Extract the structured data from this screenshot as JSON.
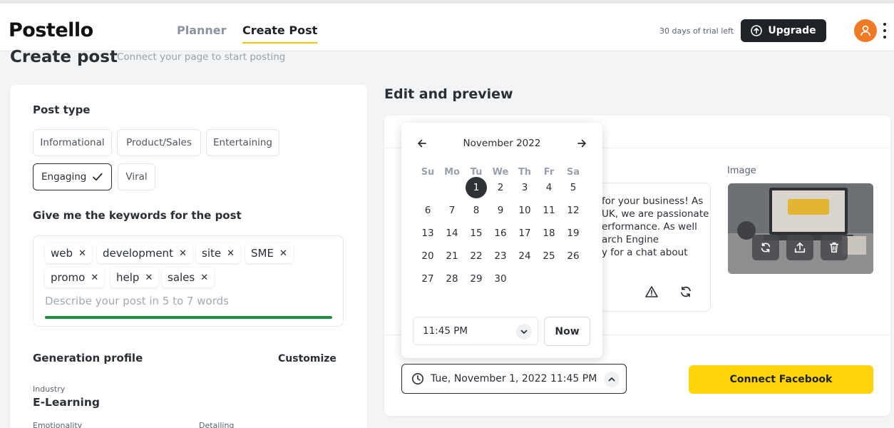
{
  "brand": {
    "logo_text": "Postello",
    "accent": "#f5c400"
  },
  "nav": {
    "planner": "Planner",
    "create_post": "Create Post"
  },
  "header": {
    "trial_text": "30 days of trial left",
    "upgrade_label": "Upgrade"
  },
  "page": {
    "title": "Create post",
    "subtitle": "Connect your page to start posting"
  },
  "post_type": {
    "label": "Post type",
    "options": [
      "Informational",
      "Product/Sales",
      "Entertaining",
      "Engaging",
      "Viral"
    ],
    "selected": "Engaging"
  },
  "keywords": {
    "label": "Give me the keywords for the post",
    "tags": [
      "web",
      "development",
      "site",
      "SME",
      "promo",
      "help",
      "sales"
    ],
    "placeholder": "Describe your post in 5 to 7 words",
    "progress_color": "#1e8f3a"
  },
  "generation_profile": {
    "label": "Generation profile",
    "customize_label": "Customize",
    "industry_label": "Industry",
    "industry_value": "E-Learning",
    "emotionality_label": "Emotionality",
    "detailing_label": "Detailing"
  },
  "preview": {
    "title": "Edit and preview",
    "post_lines": [
      "for your business! As",
      "UK, we are passionate",
      "erformance. As well",
      "arch Engine",
      "y for a chat about"
    ],
    "image_label": "Image"
  },
  "datepicker": {
    "month_label": "November 2022",
    "weekdays": [
      "Su",
      "Mo",
      "Tu",
      "We",
      "Th",
      "Fr",
      "Sa"
    ],
    "days": [
      "1",
      "2",
      "3",
      "4",
      "5",
      "6",
      "7",
      "8",
      "9",
      "10",
      "11",
      "12",
      "13",
      "14",
      "15",
      "16",
      "17",
      "18",
      "19",
      "20",
      "21",
      "22",
      "23",
      "24",
      "25",
      "26",
      "27",
      "28",
      "29",
      "30"
    ],
    "first_weekday_index": 2,
    "selected_day": "1",
    "time_value": "11:45 PM",
    "now_label": "Now"
  },
  "schedule": {
    "date_value": "Tue, November 1, 2022 11:45 PM",
    "connect_label": "Connect Facebook",
    "connect_color": "#ffd40a"
  }
}
